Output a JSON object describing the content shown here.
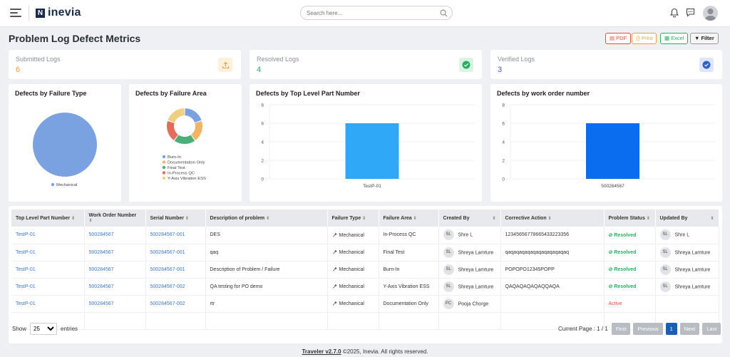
{
  "brand": {
    "name": "inevia"
  },
  "search": {
    "placeholder": "Search here..."
  },
  "page": {
    "title": "Problem Log Defect Metrics"
  },
  "actions": {
    "pdf": "PDF",
    "print": "Print",
    "excel": "Excel",
    "filter": "Filter"
  },
  "stats": [
    {
      "label": "Submitted Logs",
      "value": "6",
      "color": "#e9a23b"
    },
    {
      "label": "Resolved Logs",
      "value": "4",
      "color": "#27ae60"
    },
    {
      "label": "Verified Logs",
      "value": "3",
      "color": "#2c62c9"
    }
  ],
  "charts": {
    "failure_type_title": "Defects by Failure Type",
    "failure_area_title": "Defects by Failure Area",
    "part_number_title": "Defects by Top Level Part Number",
    "work_order_title": "Defects by work order number"
  },
  "chart_data": [
    {
      "type": "pie",
      "title": "Defects by Failure Type",
      "labels": [
        "Mechanical"
      ],
      "values": [
        5
      ],
      "colors": [
        "#7ba2e0"
      ],
      "legend": "bottom"
    },
    {
      "type": "pie",
      "title": "Defects by Failure Area",
      "labels": [
        "Burn-In",
        "Documentation Only",
        "Final Test",
        "In-Process QC",
        "Y-Axis Vibration ESS"
      ],
      "values": [
        1,
        1,
        1,
        1,
        1
      ],
      "colors": [
        "#7ba2e0",
        "#f2b466",
        "#4caf7a",
        "#e26d5a",
        "#f0d080"
      ],
      "legend": "bottom"
    },
    {
      "type": "bar",
      "title": "Defects by Top Level Part Number",
      "categories": [
        "TestP-01"
      ],
      "values": [
        6
      ],
      "ylim": [
        0,
        8
      ],
      "yticks": [
        0,
        2,
        4,
        6,
        8
      ],
      "color": "#2ea8f7"
    },
    {
      "type": "bar",
      "title": "Defects by work order number",
      "categories": [
        "500284567"
      ],
      "values": [
        6
      ],
      "ylim": [
        0,
        8
      ],
      "yticks": [
        0,
        2,
        4,
        6,
        8
      ],
      "color": "#0a6df0"
    }
  ],
  "table": {
    "headers": [
      "Top Level Part Number",
      "Work Order Number",
      "Serial Number",
      "Description of problem",
      "Failure Type",
      "Failure Area",
      "Created By",
      "Corrective Action",
      "Problem Status",
      "Updated By"
    ],
    "rows": [
      {
        "part": "TestP-01",
        "wo": "500284567",
        "serial": "500284567-001",
        "desc": "DES",
        "ftype": "Mechanical",
        "farea": "In-Process QC",
        "cby_i": "SL",
        "cby": "Shre L",
        "action": "12345656778665433223356",
        "status": "Resolved",
        "uby_i": "SL",
        "uby": "Shre L"
      },
      {
        "part": "TestP-01",
        "wo": "500284567",
        "serial": "500284567-001",
        "desc": "qaq",
        "ftype": "Mechanical",
        "farea": "Final Test",
        "cby_i": "SL",
        "cby": "Shreya Lamture",
        "action": "qaqaqaqaqaqaqaqaqaqaqaq",
        "status": "Resolved",
        "uby_i": "SL",
        "uby": "Shreya Lamture"
      },
      {
        "part": "TestP-01",
        "wo": "500284567",
        "serial": "500284567-001",
        "desc": "Description of Problem / Failure",
        "ftype": "Mechanical",
        "farea": "Burn-In",
        "cby_i": "SL",
        "cby": "Shreya Lamture",
        "action": "POPOPO12345POPP",
        "status": "Resolved",
        "uby_i": "SL",
        "uby": "Shreya Lamture"
      },
      {
        "part": "TestP-01",
        "wo": "500284567",
        "serial": "500284567-002",
        "desc": "QA testing for PO demo",
        "ftype": "Mechanical",
        "farea": "Y-Axis Vibration ESS",
        "cby_i": "SL",
        "cby": "Shreya Lamture",
        "action": "QAQAQAQAQAQQAQA",
        "status": "Resolved",
        "uby_i": "SL",
        "uby": "Shreya Lamture"
      },
      {
        "part": "TestP-01",
        "wo": "500284567",
        "serial": "500284567-002",
        "desc": "rtr",
        "ftype": "Mechanical",
        "farea": "Documentation Only",
        "cby_i": "PC",
        "cby": "Pooja Chorge",
        "action": "",
        "status": "Active",
        "uby_i": "",
        "uby": ""
      }
    ]
  },
  "footer": {
    "show": "Show",
    "entries": "entries",
    "page_size": "25",
    "current_page": "Current Page : 1 / 1",
    "first": "First",
    "previous": "Previous",
    "page": "1",
    "next": "Next",
    "last": "Last",
    "version": "Traveler v2.7.0",
    "copyright": " ©2025, Inevia. All rights reserved."
  }
}
